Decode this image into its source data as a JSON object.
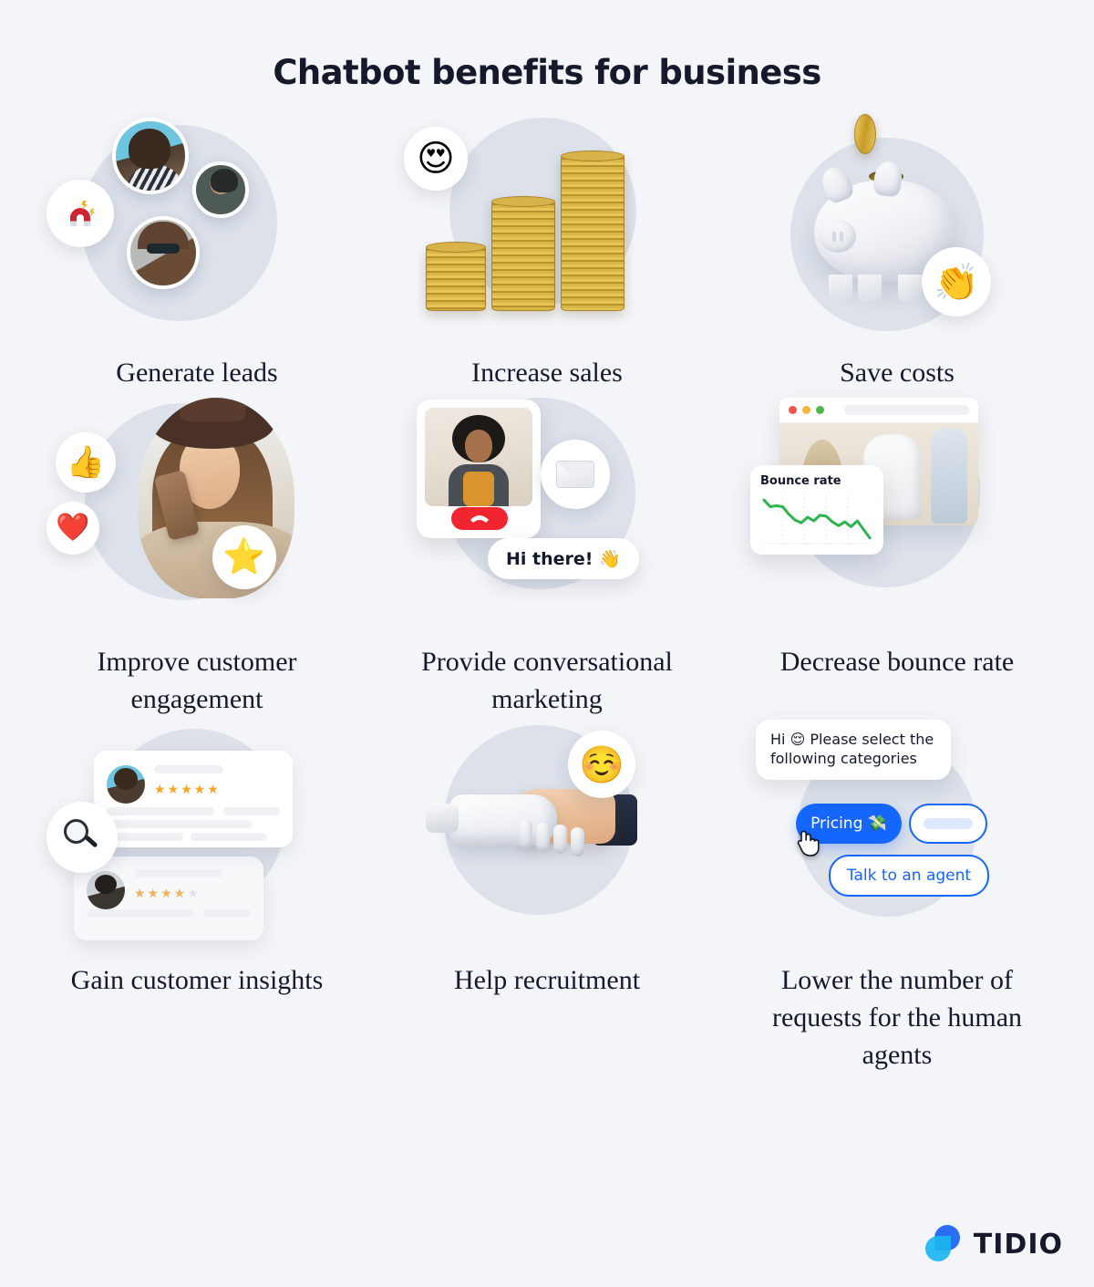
{
  "page": {
    "title": "Chatbot benefits for business",
    "background_color": "#f4f5f8",
    "text_color": "#141a2b",
    "circle_backdrop_color": "#dce1ea",
    "accent_blue": "#1565ff",
    "chart_green": "#2eb44e"
  },
  "benefits": [
    {
      "label": "Generate leads",
      "illustration": "three-customer-avatars-with-magnet",
      "badges": [
        "magnet-icon"
      ]
    },
    {
      "label": "Increase sales",
      "illustration": "three-growing-gold-coin-stacks",
      "badges": [
        "heart-eyes-emoji"
      ],
      "emoji": "😍"
    },
    {
      "label": "Save costs",
      "illustration": "white-piggy-bank-with-falling-coin",
      "badges": [
        "clapping-hands-emoji"
      ],
      "emoji": "👏"
    },
    {
      "label": "Improve customer engagement",
      "illustration": "woman-with-hat-holding-phone",
      "badges": [
        "thumbs-up-emoji",
        "red-heart-emoji",
        "star-emoji"
      ],
      "emoji_thumb": "👍",
      "emoji_heart": "❤️",
      "emoji_star": "⭐"
    },
    {
      "label": "Provide conversational marketing",
      "illustration": "video-call-card-with-chat-bubble",
      "bubble_text": "Hi there! 👋",
      "badges": [
        "envelope-icon"
      ]
    },
    {
      "label": "Decrease bounce rate",
      "illustration": "browser-window-with-bounce-rate-chart",
      "chart_card_title": "Bounce rate"
    },
    {
      "label": "Gain customer insights",
      "illustration": "customer-review-cards-with-magnifier",
      "review_top_stars": 5,
      "review_bottom_stars": 4,
      "review_max_stars": 5,
      "badges": [
        "magnifying-glass-icon"
      ]
    },
    {
      "label": "Help recruitment",
      "illustration": "robot-hand-shaking-human-hand",
      "badges": [
        "relieved-smile-emoji"
      ],
      "emoji": "☺️"
    },
    {
      "label": "Lower the number of requests for the human agents",
      "illustration": "chatbot-quick-reply-buttons",
      "chat_message": "Hi 😌 Please select the following categories",
      "chips": [
        "Pricing 💸",
        "",
        "Talk to an agent"
      ],
      "chip_pricing_label": "Pricing 💸",
      "chip_agent_label": "Talk to an agent",
      "cursor": "🗒"
    }
  ],
  "chart_data": {
    "type": "line",
    "title": "Bounce rate",
    "xlabel": "",
    "ylabel": "",
    "grid": "vertical-dotted",
    "legend": "none",
    "color": "#2eb44e",
    "x": [
      0,
      1,
      2,
      3,
      4,
      5,
      6,
      7,
      8,
      9,
      10,
      11,
      12,
      13,
      14,
      15,
      16,
      17
    ],
    "values": [
      88,
      74,
      76,
      74,
      58,
      46,
      40,
      52,
      44,
      56,
      54,
      42,
      34,
      42,
      32,
      44,
      26,
      8
    ],
    "ylim": [
      0,
      100
    ],
    "trend": "decreasing"
  },
  "logo": {
    "text": "TIDIO",
    "mark_dark_color": "#2b6df5",
    "mark_light_color": "#1ab5f1"
  }
}
